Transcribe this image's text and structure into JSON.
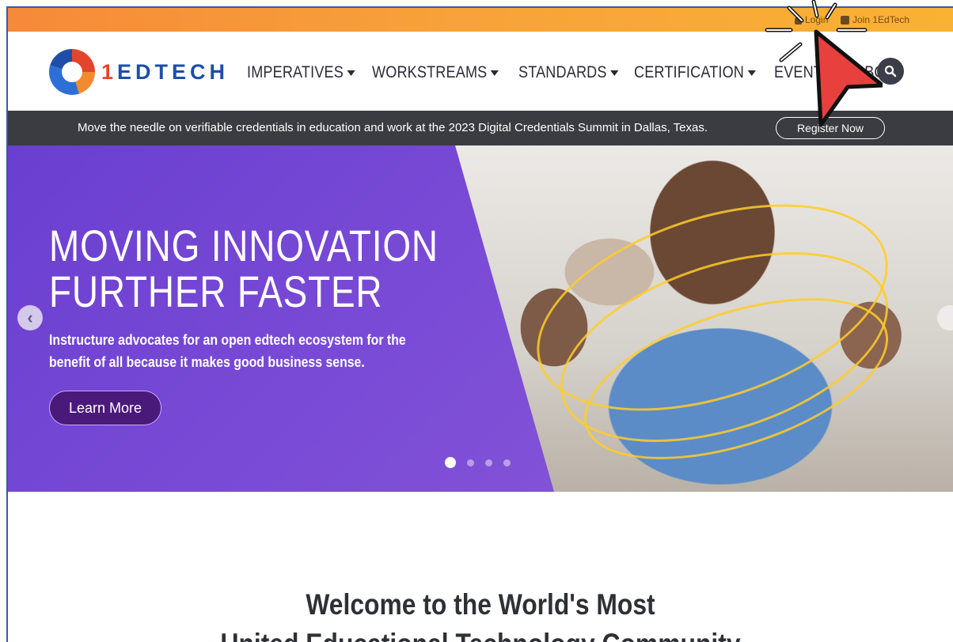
{
  "utility": {
    "login": "Login",
    "join": "Join 1EdTech"
  },
  "logo": {
    "one": "1",
    "rest": "EDTECH"
  },
  "nav": [
    {
      "label": "IMPERATIVES"
    },
    {
      "label": "WORKSTREAMS"
    },
    {
      "label": "STANDARDS"
    },
    {
      "label": "CERTIFICATION"
    },
    {
      "label": "EVENTS"
    },
    {
      "label": "ABOU"
    }
  ],
  "announcement": {
    "text": "Move the needle on verifiable credentials in education and work at the 2023 Digital Credentials Summit in Dallas, Texas.",
    "button": "Register Now"
  },
  "hero": {
    "title_line1": "MOVING INNOVATION",
    "title_line2": "FURTHER FASTER",
    "subtitle": "Instructure advocates for an open edtech ecosystem for the benefit of all because it makes good business sense.",
    "button": "Learn More",
    "slides": {
      "current": 1,
      "total": 4
    }
  },
  "welcome": {
    "line1": "Welcome to the World's Most",
    "line2": "United Educational Technology Community"
  },
  "icons": {
    "login": "person-icon",
    "join": "id-card-icon",
    "search": "search-icon",
    "prev": "chevron-left-icon",
    "next": "chevron-right-icon",
    "cursor": "click-cursor-icon"
  },
  "colors": {
    "topbar": "#f7a13a",
    "brand_blue": "#1d4fa5",
    "brand_red": "#e2452b",
    "announce_bg": "#3a3c42",
    "hero_purple": "#7a4bd6",
    "cursor_red": "#e8403c"
  }
}
